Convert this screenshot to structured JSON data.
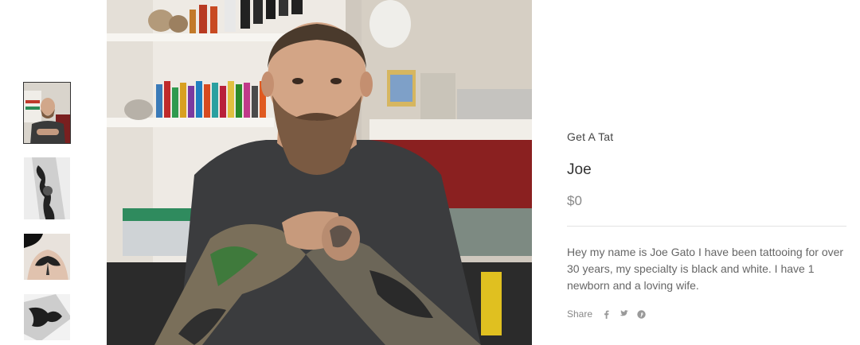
{
  "product": {
    "vendor": "Get A Tat",
    "title": "Joe",
    "price": "$0",
    "description": "Hey my name is Joe Gato I have been tattooing for over 30 years, my specialty is black and white. I have 1 newborn and a loving wife."
  },
  "share": {
    "label": "Share",
    "networks": [
      "facebook-icon",
      "twitter-icon",
      "pinterest-icon"
    ]
  },
  "gallery": {
    "thumbnails": [
      "artist-portrait",
      "arm-tattoo-1",
      "back-moth-tattoo",
      "arm-tattoo-2"
    ],
    "active_index": 0
  },
  "colors": {
    "text_primary": "#333333",
    "text_muted": "#888888",
    "divider": "#e3e3e3",
    "thumb_active_border": "#333333"
  }
}
